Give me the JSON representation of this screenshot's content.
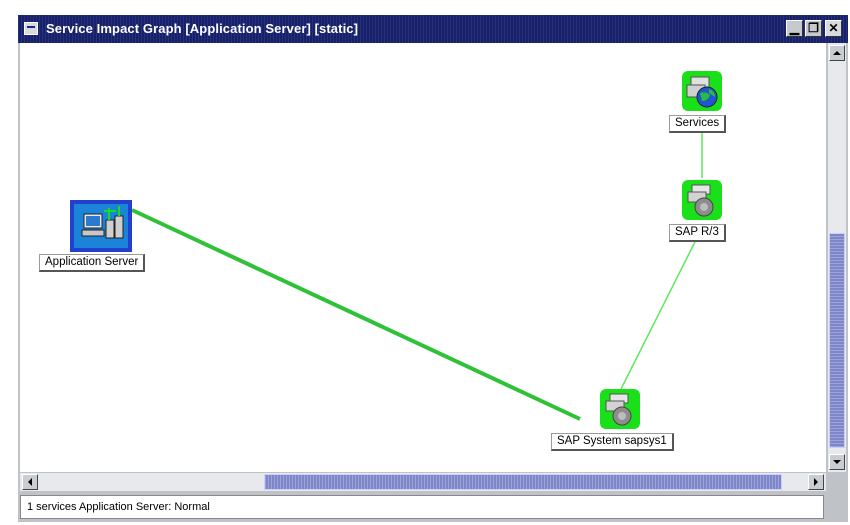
{
  "window": {
    "title": "Service Impact Graph [Application Server] [static]",
    "buttons": {
      "minimize": "▁",
      "restore": "❐",
      "close": "✕"
    }
  },
  "graph": {
    "nodes": {
      "application_server": {
        "label": "Application Server",
        "icon": "application-server-icon"
      },
      "services": {
        "label": "Services",
        "icon": "services-globe-icon"
      },
      "sap_r3": {
        "label": "SAP R/3",
        "icon": "sap-system-icon"
      },
      "sap_system_sapsys1": {
        "label": "SAP System sapsys1",
        "icon": "sap-system-icon"
      }
    },
    "edges": [
      {
        "from": "Application Server",
        "to": "SAP System sapsys1"
      },
      {
        "from": "SAP System sapsys1",
        "to": "SAP R/3"
      },
      {
        "from": "SAP R/3",
        "to": "Services"
      }
    ],
    "colors": {
      "edge": "#39d23c",
      "node_ok": "#19e019",
      "selected": "#2140d0",
      "background": "#ffffff"
    }
  },
  "statusbar": {
    "text": "1 services  Application Server: Normal"
  }
}
